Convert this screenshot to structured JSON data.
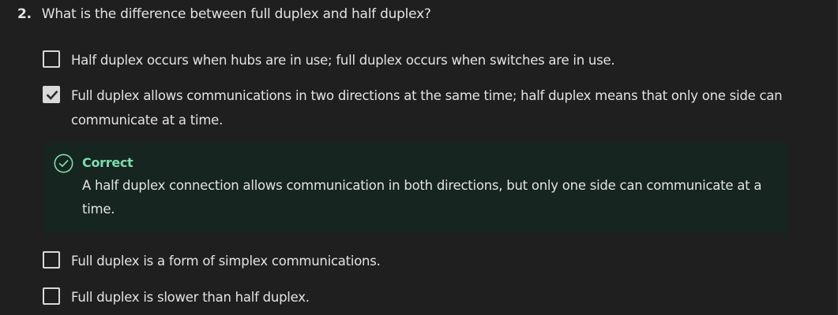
{
  "question": {
    "number": "2.",
    "text": "What is the difference between full duplex and half duplex?"
  },
  "options": [
    {
      "text": "Half duplex occurs when hubs are in use; full duplex occurs when switches are in use.",
      "checked": false
    },
    {
      "text": "Full duplex allows communications in two directions at the same time; half duplex means that only one side can communicate at a time.",
      "checked": true
    },
    {
      "text": "Full duplex is a form of simplex communications.",
      "checked": false
    },
    {
      "text": "Full duplex is slower than half duplex.",
      "checked": false
    }
  ],
  "feedback": {
    "title": "Correct",
    "text": "A half duplex connection allows communication in both directions, but only one side can communicate at a time.",
    "icon": "check-circle-icon",
    "accent_color": "#7fdcae",
    "background_color": "#16251f"
  },
  "colors": {
    "page_background": "#1f1f1f",
    "text": "#e3e3e3",
    "checkbox": "#d9d9d9"
  }
}
